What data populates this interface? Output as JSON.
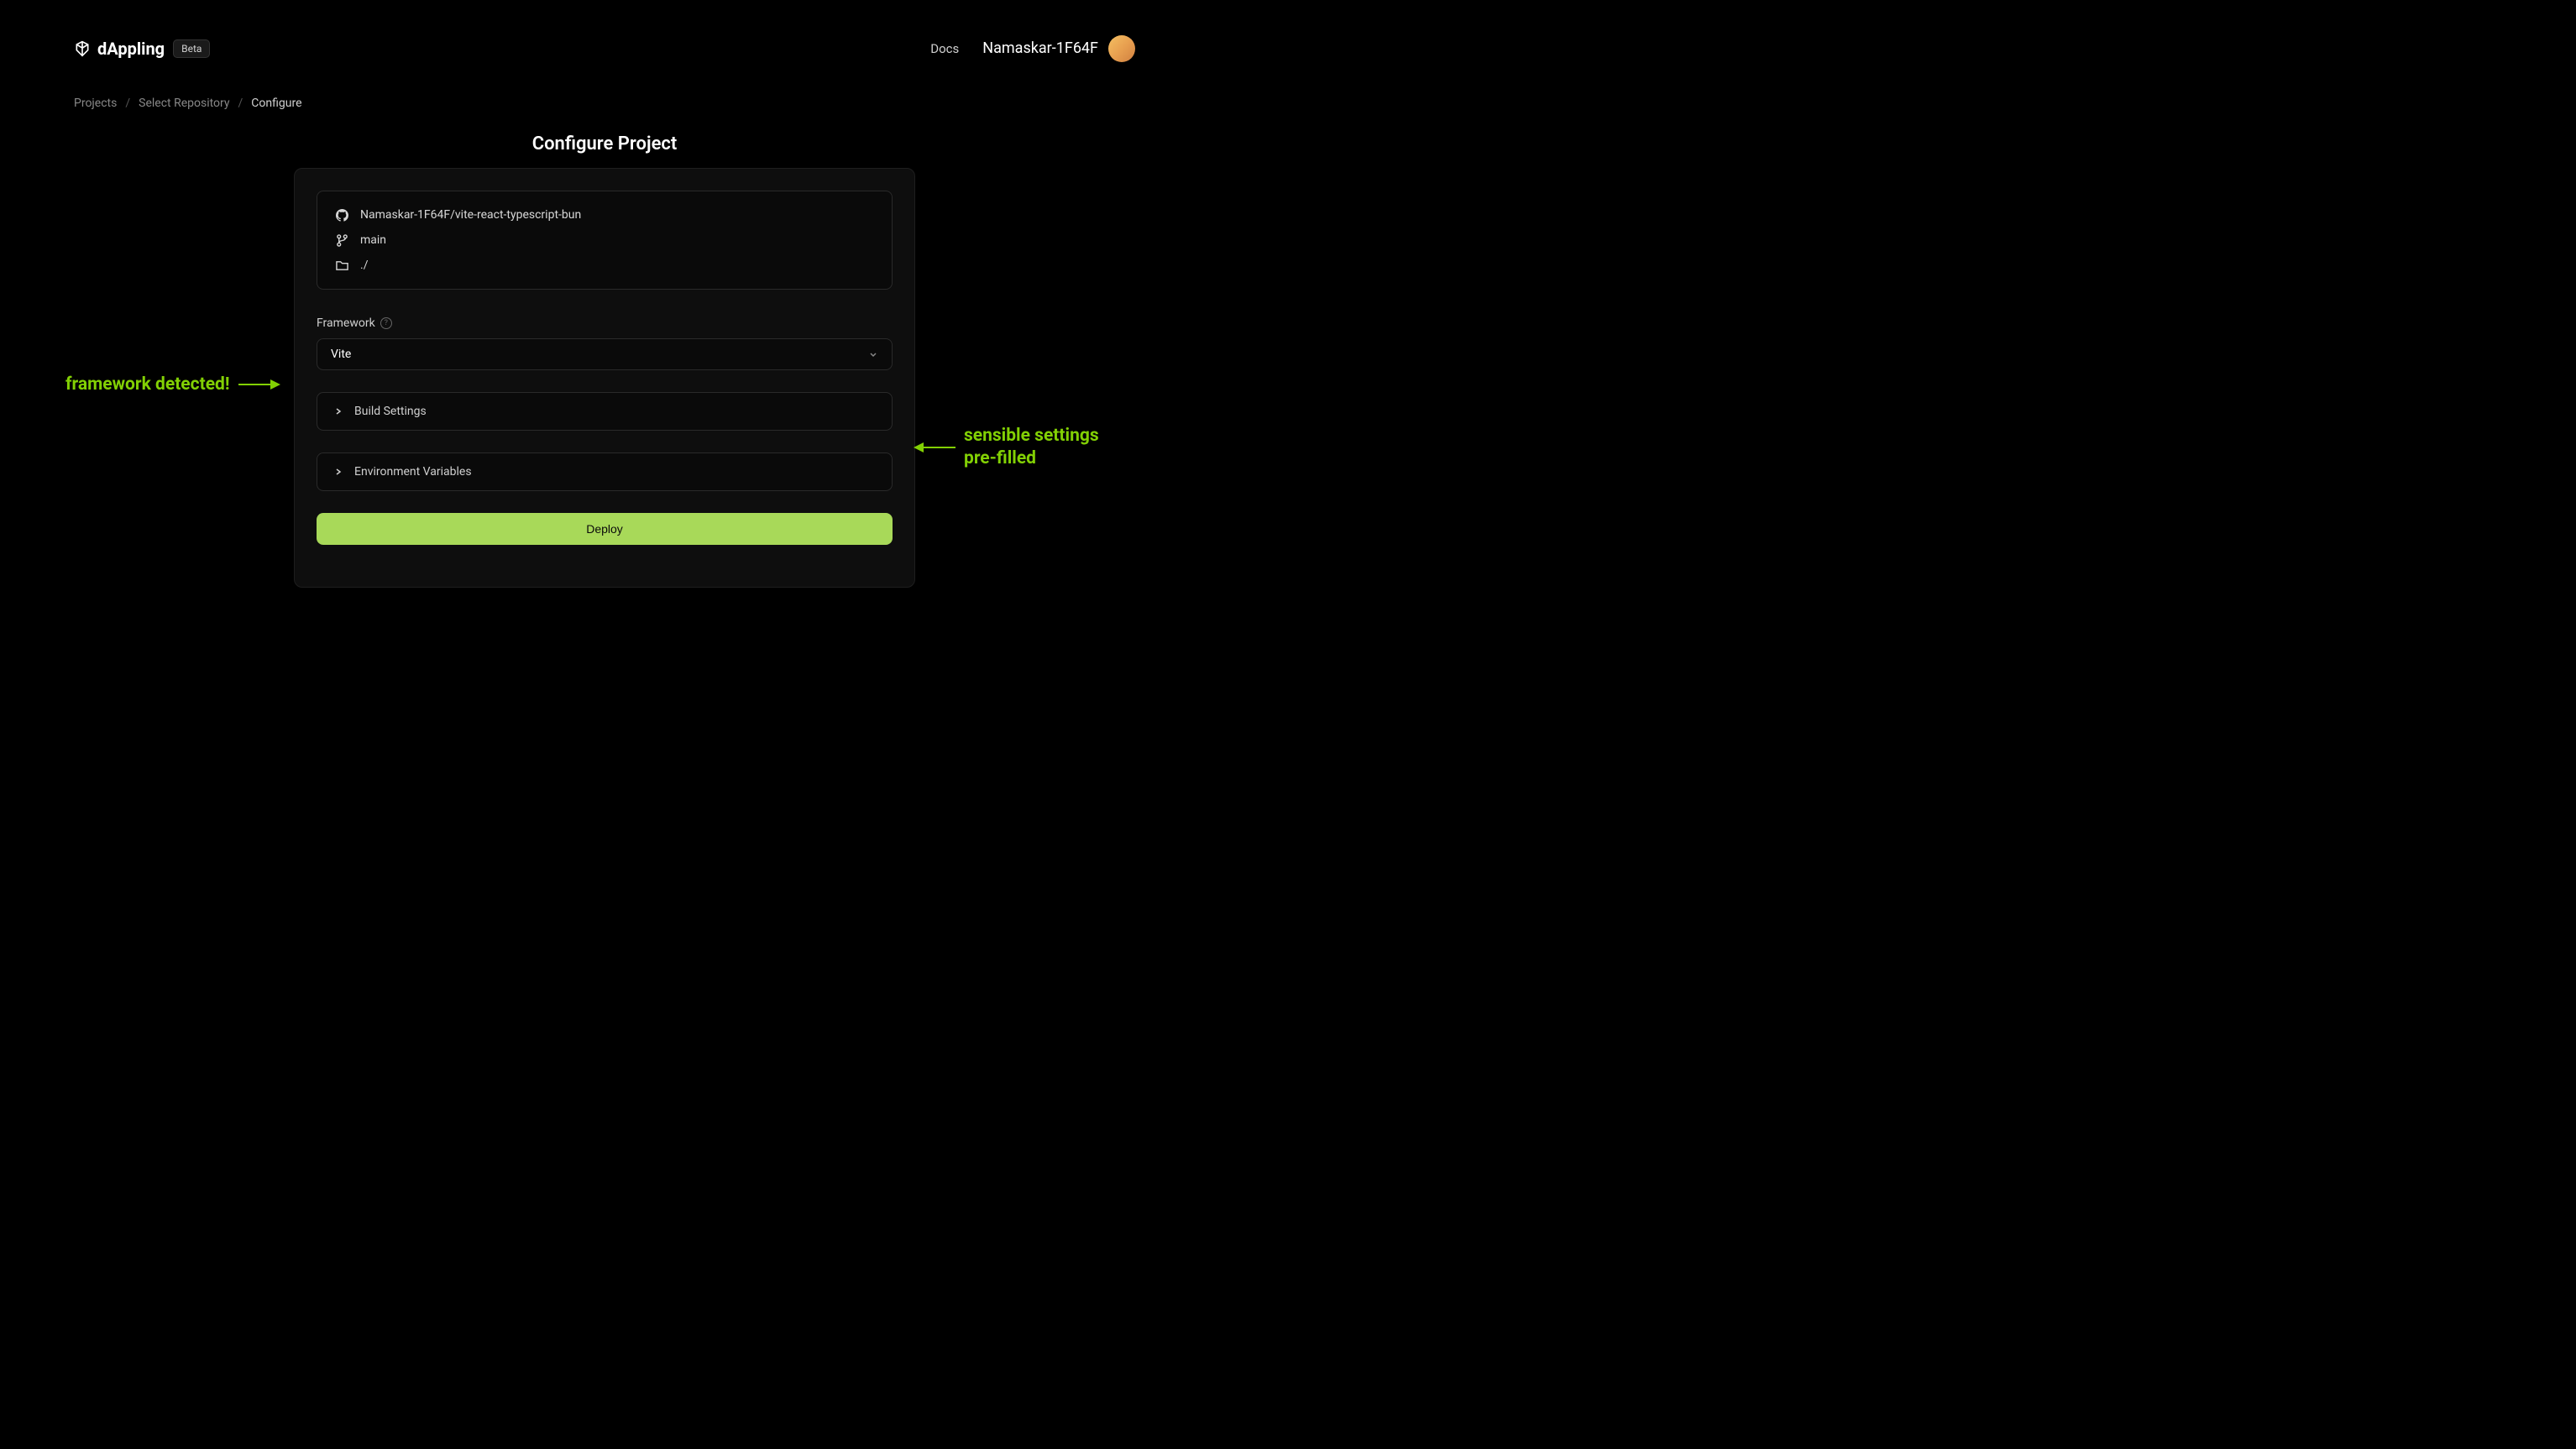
{
  "header": {
    "logo_text": "dAppling",
    "beta_badge": "Beta",
    "docs_label": "Docs",
    "username": "Namaskar-1F64F"
  },
  "breadcrumbs": {
    "items": [
      "Projects",
      "Select Repository",
      "Configure"
    ]
  },
  "page": {
    "title": "Configure Project"
  },
  "repo_info": {
    "repository": "Namaskar-1F64F/vite-react-typescript-bun",
    "branch": "main",
    "directory": "./"
  },
  "framework": {
    "label": "Framework",
    "selected": "Vite"
  },
  "sections": {
    "build_settings": "Build Settings",
    "env_variables": "Environment Variables"
  },
  "deploy_button": "Deploy",
  "annotations": {
    "left": "framework detected!",
    "right_line1": "sensible settings",
    "right_line2": "pre-filled"
  },
  "colors": {
    "accent": "#a8d959",
    "annotation": "#82d004"
  }
}
